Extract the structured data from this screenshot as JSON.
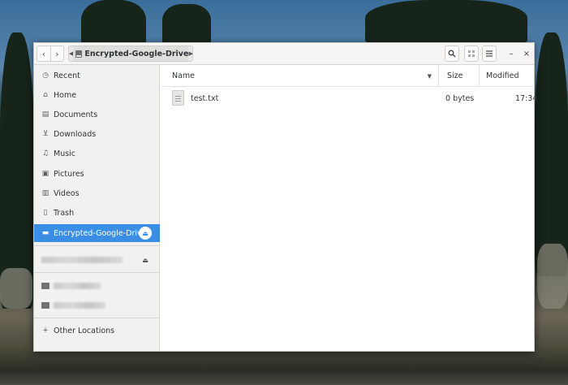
{
  "window": {
    "path_segment": "Encrypted-Google-Drive"
  },
  "headerbar": {
    "back_icon": "chevron-left-icon",
    "forward_icon": "chevron-right-icon",
    "search_icon": "search-icon",
    "view_icon": "grid-view-icon",
    "menu_icon": "hamburger-menu-icon",
    "minimize_glyph": "–",
    "close_glyph": "×"
  },
  "sidebar": {
    "items": [
      {
        "label": "Recent",
        "icon": "clock-icon"
      },
      {
        "label": "Home",
        "icon": "home-icon"
      },
      {
        "label": "Documents",
        "icon": "document-icon"
      },
      {
        "label": "Downloads",
        "icon": "download-icon"
      },
      {
        "label": "Music",
        "icon": "music-icon"
      },
      {
        "label": "Pictures",
        "icon": "picture-icon"
      },
      {
        "label": "Videos",
        "icon": "video-icon"
      },
      {
        "label": "Trash",
        "icon": "trash-icon"
      },
      {
        "label": "Encrypted-Google-Drive",
        "icon": "drive-icon",
        "active": true
      }
    ],
    "other_locations": "Other Locations"
  },
  "columns": {
    "name": "Name",
    "size": "Size",
    "modified": "Modified"
  },
  "files": [
    {
      "name": "test.txt",
      "size": "0 bytes",
      "modified": "17:34",
      "icon": "text-file-icon"
    }
  ],
  "colors": {
    "accent": "#3a8ee6"
  }
}
